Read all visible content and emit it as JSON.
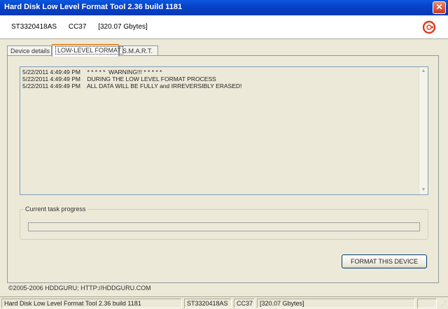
{
  "window": {
    "title": "Hard Disk Low Level Format Tool 2.36 build 1181",
    "close_glyph": "✕"
  },
  "header": {
    "model": "ST3320418AS",
    "firmware": "CC37",
    "capacity": "[320.07 Gbytes]",
    "logo_icon": "hddguru-logo-icon"
  },
  "tabs": [
    {
      "label": "Device details",
      "active": false
    },
    {
      "label": "LOW-LEVEL FORMAT",
      "active": true
    },
    {
      "label": "S.M.A.R.T.",
      "active": false
    }
  ],
  "log": {
    "lines": [
      "5/22/2011 4:49:49 PM    * * * * *  WARNING!!! * * * * *",
      "5/22/2011 4:49:49 PM    DURING THE LOW LEVEL FORMAT PROCESS",
      "5/22/2011 4:49:49 PM    ALL DATA WILL BE FULLY and IRREVERSIBLY ERASED!"
    ],
    "scroll_up_glyph": "▲",
    "scroll_down_glyph": "▼"
  },
  "progress": {
    "label": "Current task progress",
    "value": 0
  },
  "buttons": {
    "format": "FORMAT THIS DEVICE"
  },
  "footer": {
    "copyright": "©2005-2006 HDDGURU;  HTTP://HDDGURU.COM"
  },
  "statusbar": {
    "app": "Hard Disk Low Level Format Tool 2.36 build 1181",
    "model": "ST3320418AS",
    "firmware": "CC37",
    "capacity": "[320.07 Gbytes]",
    "grip_glyph": "⋰"
  }
}
